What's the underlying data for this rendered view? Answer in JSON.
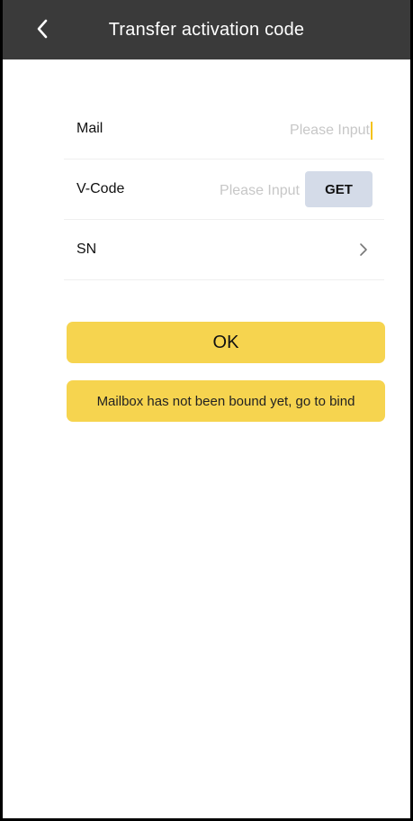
{
  "header": {
    "title": "Transfer activation code",
    "back_icon": "chevron-left-icon"
  },
  "form": {
    "mail": {
      "label": "Mail",
      "placeholder": "Please Input",
      "value": ""
    },
    "vcode": {
      "label": "V-Code",
      "placeholder": "Please Input",
      "value": "",
      "get_label": "GET"
    },
    "sn": {
      "label": "SN",
      "icon": "chevron-right-icon"
    }
  },
  "buttons": {
    "ok_label": "OK"
  },
  "notice": {
    "text": "Mailbox has not been bound yet, go to bind"
  },
  "colors": {
    "header_bg": "#3a3a3a",
    "accent_yellow": "#f6d44f",
    "get_button_bg": "#d4dbe8",
    "caret": "#f4c21a"
  }
}
